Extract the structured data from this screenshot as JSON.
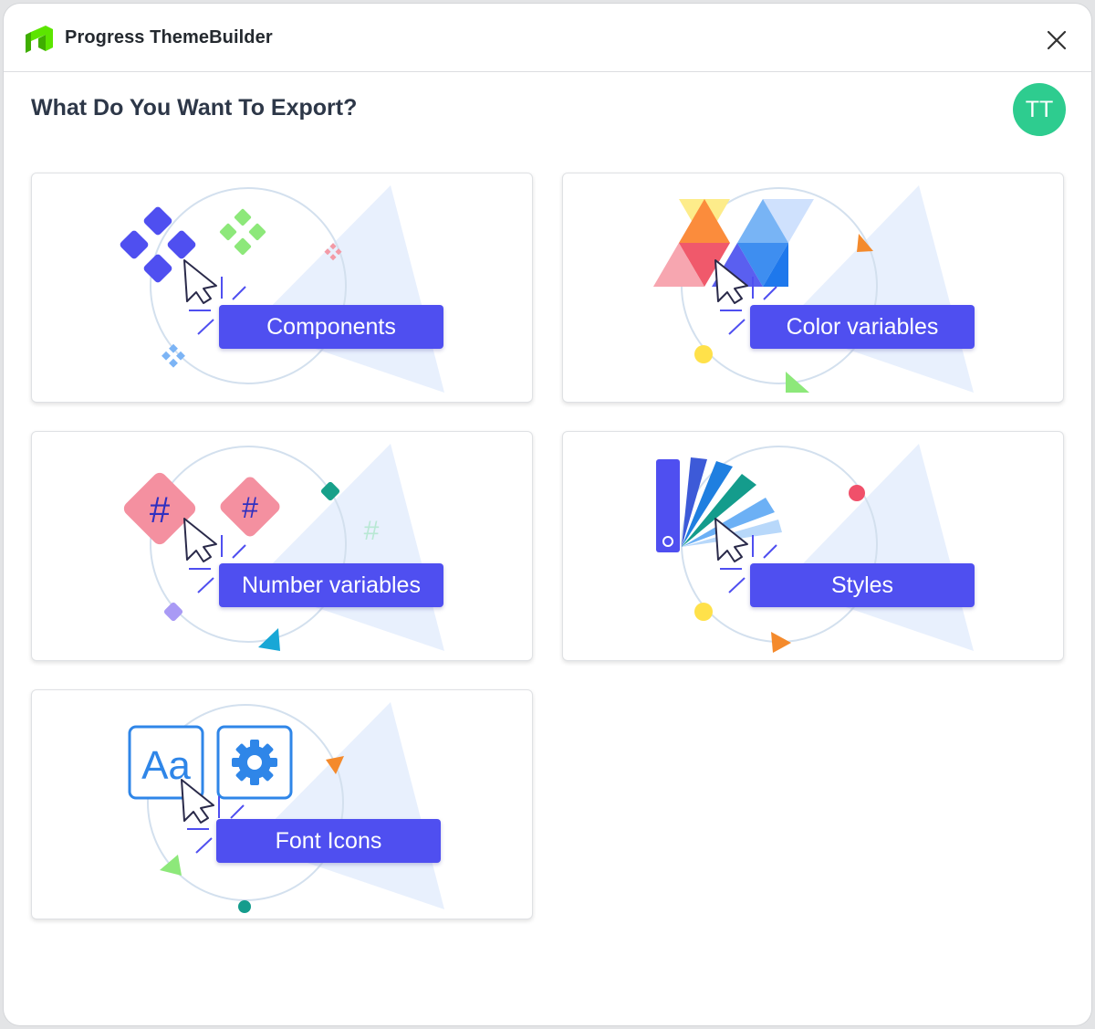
{
  "app": {
    "title": "Progress ThemeBuilder",
    "logo_icon": "progress-logo-icon",
    "close_icon": "close-icon"
  },
  "dialog": {
    "heading": "What Do You Want To Export?",
    "avatar_initials": "TT"
  },
  "options": [
    {
      "label": "Components",
      "icon": "components-illustration"
    },
    {
      "label": "Color variables",
      "icon": "color-variables-illustration"
    },
    {
      "label": "Number variables",
      "icon": "number-variables-illustration"
    },
    {
      "label": "Styles",
      "icon": "styles-illustration"
    },
    {
      "label": "Font Icons",
      "icon": "font-icons-illustration"
    }
  ],
  "illustration_text": {
    "hash": "#",
    "font_sample": "Aa"
  },
  "colors": {
    "accent": "#4f4ff0",
    "avatar": "#2ecc8f",
    "logo_green": "#5ce500"
  }
}
